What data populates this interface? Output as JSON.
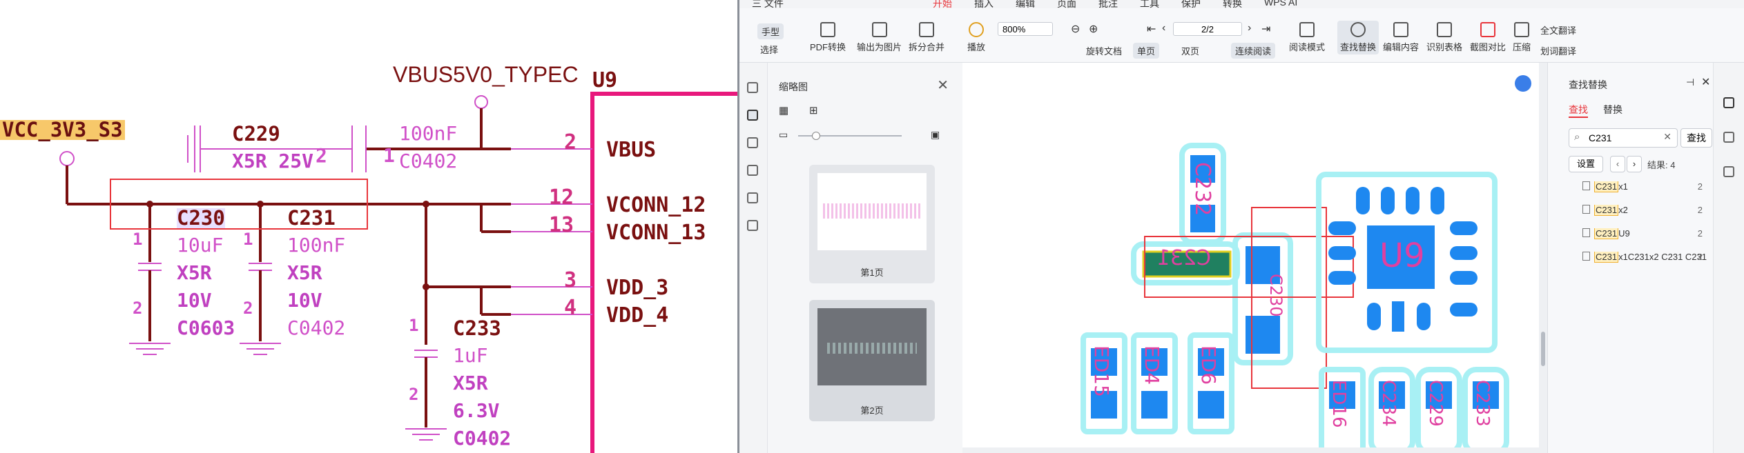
{
  "schematic": {
    "net_vbus": "VBUS5V0_TYPEC",
    "net_vcc": "VCC_3V3_S3",
    "u9_label": "U9",
    "pins": [
      {
        "name": "VBUS",
        "num": "2"
      },
      {
        "name": "VCONN_12",
        "num": "12"
      },
      {
        "name": "VCONN_13",
        "num": "13"
      },
      {
        "name": "VDD_3",
        "num": "3"
      },
      {
        "name": "VDD_4",
        "num": "4"
      }
    ],
    "c229": {
      "ref": "C229",
      "spec": "X5R 25V",
      "pin1": "1",
      "pin2": "2",
      "val": "100nF",
      "pkg": "C0402"
    },
    "c230": {
      "ref": "C230",
      "val": "10uF",
      "diel": "X5R",
      "volt": "10V",
      "pkg": "C0603",
      "pin1": "1",
      "pin2": "2"
    },
    "c231": {
      "ref": "C231",
      "val": "100nF",
      "diel": "X5R",
      "volt": "10V",
      "pkg": "C0402",
      "pin1": "1",
      "pin2": "2"
    },
    "c233": {
      "ref": "C233",
      "val": "1uF",
      "diel": "X5R",
      "volt": "6.3V",
      "pkg": "C0402",
      "pin1": "1",
      "pin2": "2"
    }
  },
  "app": {
    "menubar": [
      "三 文件",
      "开始",
      "插入",
      "编辑",
      "页面",
      "批注",
      "工具",
      "保护",
      "转换",
      "WPS AI"
    ],
    "toolbar": {
      "hand": "手型",
      "select": "选择",
      "pdf_convert": "PDF转换",
      "export_img": "输出为图片",
      "split_merge": "拆分合并",
      "play": "播放",
      "zoom": "800%",
      "page": "2/2",
      "rotate": "旋转文档",
      "single": "单页",
      "double": "双页",
      "continuous": "连续阅读",
      "read_mode": "阅读模式",
      "find_replace": "查找替换",
      "edit_content": "编辑内容",
      "ocr_table": "识别表格",
      "compare": "截图对比",
      "compress": "压缩",
      "full_translate": "全文翻译",
      "word_translate": "划词翻译"
    },
    "thumbs": {
      "title": "缩略图",
      "pages": [
        {
          "label": "第1页"
        },
        {
          "label": "第2页"
        }
      ]
    },
    "pcb": {
      "labels": [
        "C231",
        "C232",
        "C230",
        "U9",
        "ED15",
        "ED4",
        "ED6",
        "ED16",
        "C234",
        "C229",
        "C233"
      ]
    },
    "find": {
      "title": "查找替换",
      "tab_find": "查找",
      "tab_replace": "替换",
      "query": "C231",
      "find_button": "查找",
      "settings_button": "设置",
      "result_text": "结果: 4",
      "results": [
        {
          "hit": "C231",
          "rest": "x1",
          "count": "2"
        },
        {
          "hit": "C231",
          "rest": "x2",
          "count": "2"
        },
        {
          "hit": "C231",
          "rest": "U9",
          "count": "2"
        },
        {
          "hit": "C231",
          "rest": "x1C231x2 C231 C231",
          "count": "2"
        }
      ]
    },
    "colors": {
      "accent": "#e8353b",
      "pad": "#1e88f0",
      "silk": "#a8f0f4"
    }
  }
}
